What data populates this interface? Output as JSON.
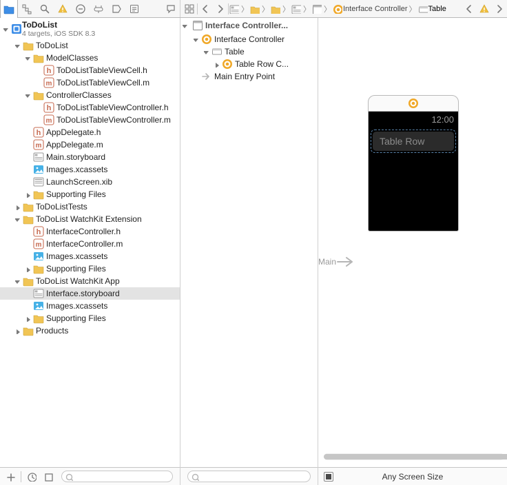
{
  "colors": {
    "selBlue": "#1d7bdd",
    "folderYellow": "#f1c555",
    "xcodeBlue": "#2f7de0",
    "amberIcon": "#f0a828"
  },
  "project": {
    "name": "ToDoList",
    "subtitle": "4 targets, iOS SDK 8.3"
  },
  "breadcrumbs": [
    {
      "icon": "storyboard",
      "label": ""
    },
    {
      "icon": "folder",
      "label": ""
    },
    {
      "icon": "folder",
      "label": ""
    },
    {
      "icon": "storyboard",
      "label": ""
    },
    {
      "icon": "scene",
      "label": ""
    },
    {
      "icon": "controller",
      "label": "Interface Controller"
    },
    {
      "icon": "cell",
      "label": "Table"
    }
  ],
  "tree": [
    {
      "d": 0,
      "icon": "proj",
      "label": "ToDoList",
      "open": true,
      "header": true
    },
    {
      "d": 1,
      "icon": "folder",
      "label": "ToDoList",
      "open": true
    },
    {
      "d": 2,
      "icon": "folder",
      "label": "ModelClasses",
      "open": true
    },
    {
      "d": 3,
      "icon": "h",
      "label": "ToDoListTableViewCell.h"
    },
    {
      "d": 3,
      "icon": "m",
      "label": "ToDoListTableViewCell.m"
    },
    {
      "d": 2,
      "icon": "folder",
      "label": "ControllerClasses",
      "open": true
    },
    {
      "d": 3,
      "icon": "h",
      "label": "ToDoListTableViewController.h"
    },
    {
      "d": 3,
      "icon": "m",
      "label": "ToDoListTableViewController.m"
    },
    {
      "d": 2,
      "icon": "h",
      "label": "AppDelegate.h"
    },
    {
      "d": 2,
      "icon": "m",
      "label": "AppDelegate.m"
    },
    {
      "d": 2,
      "icon": "storyboard",
      "label": "Main.storyboard"
    },
    {
      "d": 2,
      "icon": "assets",
      "label": "Images.xcassets"
    },
    {
      "d": 2,
      "icon": "xib",
      "label": "LaunchScreen.xib"
    },
    {
      "d": 2,
      "icon": "folder",
      "label": "Supporting Files",
      "open": false
    },
    {
      "d": 1,
      "icon": "folder",
      "label": "ToDoListTests",
      "open": false
    },
    {
      "d": 1,
      "icon": "folder",
      "label": "ToDoList WatchKit Extension",
      "open": true
    },
    {
      "d": 2,
      "icon": "h",
      "label": "InterfaceController.h"
    },
    {
      "d": 2,
      "icon": "m",
      "label": "InterfaceController.m"
    },
    {
      "d": 2,
      "icon": "assets",
      "label": "Images.xcassets"
    },
    {
      "d": 2,
      "icon": "folder",
      "label": "Supporting Files",
      "open": false
    },
    {
      "d": 1,
      "icon": "folder",
      "label": "ToDoList WatchKit App",
      "open": true
    },
    {
      "d": 2,
      "icon": "storyboard",
      "label": "Interface.storyboard",
      "selected": true
    },
    {
      "d": 2,
      "icon": "assets",
      "label": "Images.xcassets"
    },
    {
      "d": 2,
      "icon": "folder",
      "label": "Supporting Files",
      "open": false
    },
    {
      "d": 1,
      "icon": "folder",
      "label": "Products",
      "open": false
    }
  ],
  "outline": {
    "header": "Interface Controller...",
    "items": [
      {
        "d": 0,
        "icon": "controller",
        "label": "Interface Controller",
        "open": true
      },
      {
        "d": 1,
        "icon": "cell",
        "label": "Table",
        "open": true
      },
      {
        "d": 2,
        "icon": "controller",
        "label": "Table Row C...",
        "open": false
      },
      {
        "d": 0,
        "icon": "entry",
        "label": "Main Entry Point"
      }
    ]
  },
  "canvas": {
    "arrowLabel": "Main",
    "clock": "12:00",
    "rowLabel": "Table Row",
    "sizeLabel": "Any Screen Size"
  }
}
